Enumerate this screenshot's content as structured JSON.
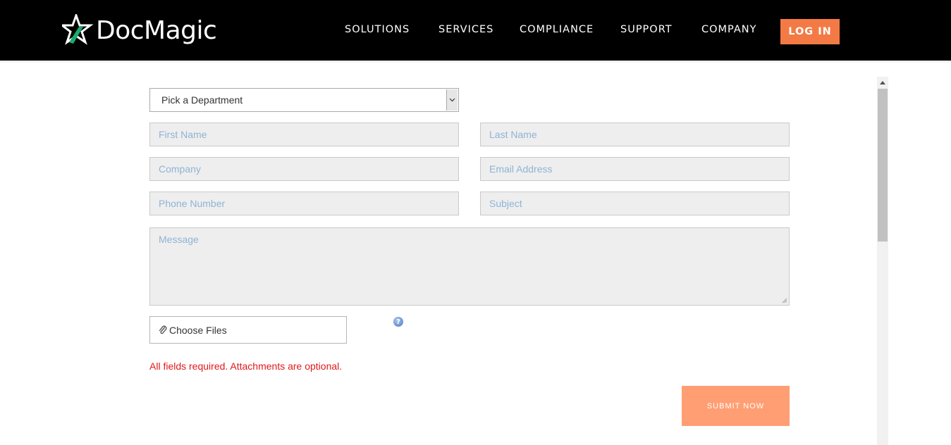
{
  "header": {
    "brand": "DocMagic",
    "nav": [
      "SOLUTIONS",
      "SERVICES",
      "COMPLIANCE",
      "SUPPORT",
      "COMPANY"
    ],
    "login_label": "LOG IN",
    "accent_color": "#f47a45",
    "logo_icon": "star-logo-icon"
  },
  "form": {
    "department_select": "Pick a Department",
    "first_name_placeholder": "First Name",
    "last_name_placeholder": "Last Name",
    "company_placeholder": "Company",
    "email_placeholder": "Email Address",
    "phone_placeholder": "Phone Number",
    "subject_placeholder": "Subject",
    "message_placeholder": "Message",
    "choose_files_label": "Choose Files",
    "help_icon_glyph": "?",
    "required_note": "All fields required. Attachments are optional.",
    "submit_label": "SUBMIT NOW",
    "submit_color": "#ff9e72",
    "placeholder_color": "#8fb3d6",
    "error_color": "#e0181b"
  }
}
